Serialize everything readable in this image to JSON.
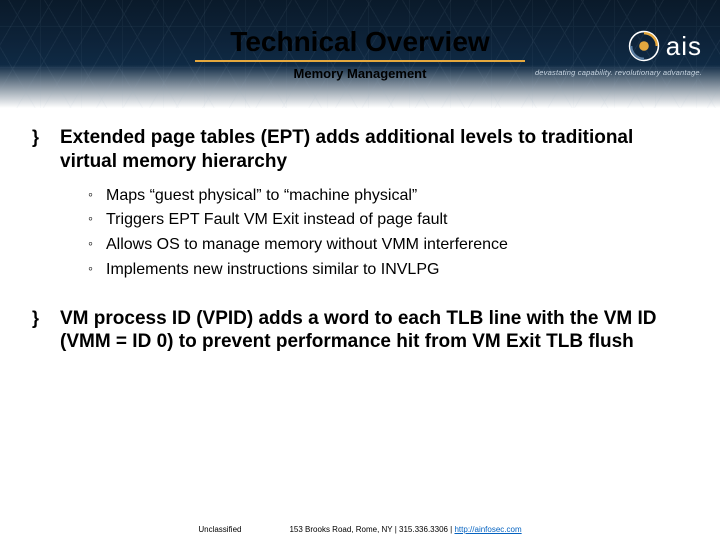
{
  "header": {
    "title": "Technical Overview",
    "subtitle": "Memory Management",
    "logo_text": "ais",
    "tagline": "devastating capability. revolutionary advantage."
  },
  "bullets": [
    {
      "text": "Extended page tables (EPT) adds additional levels to traditional virtual memory hierarchy",
      "sub": [
        "Maps “guest physical” to “machine physical”",
        "Triggers EPT Fault VM Exit instead of page fault",
        "Allows OS to manage memory without VMM interference",
        "Implements new instructions similar to INVLPG"
      ]
    },
    {
      "text": "VM process ID (VPID) adds a word to each TLB line with the VM ID (VMM = ID 0) to prevent performance hit from VM Exit TLB flush",
      "sub": []
    }
  ],
  "footer": {
    "classification": "Unclassified",
    "address": "153 Brooks Road, Rome, NY  |  315.336.3306  |  ",
    "link_text": "http://ainfosec.com"
  }
}
